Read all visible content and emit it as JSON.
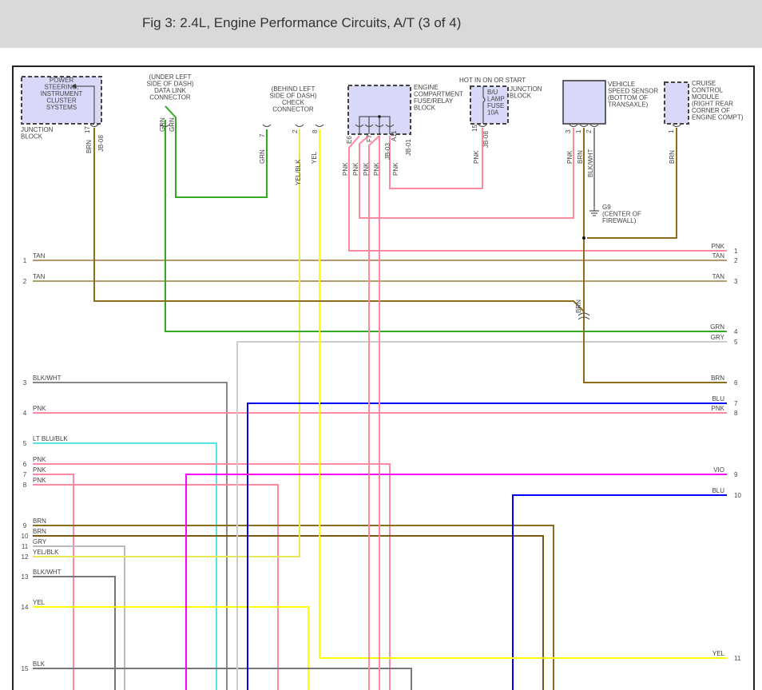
{
  "header": {
    "title": "Fig 3: 2.4L, Engine Performance Circuits, A/T (3 of 4)"
  },
  "components": {
    "power_steering": [
      "POWER",
      "STEERING,",
      "INSTRUMENT",
      "CLUSTER",
      "SYSTEMS"
    ],
    "junction_block_left": [
      "JUNCTION",
      "BLOCK"
    ],
    "data_link": [
      "(UNDER LEFT",
      "SIDE OF DASH)",
      "DATA LINK",
      "CONNECTOR"
    ],
    "check_connector": [
      "(BEHIND LEFT",
      "SIDE OF DASH)",
      "CHECK",
      "CONNECTOR"
    ],
    "fuse_relay": [
      "ENGINE",
      "COMPARTMENT",
      "FUSE/RELAY",
      "BLOCK"
    ],
    "hot_in": "HOT IN ON OR START",
    "bu_fuse": [
      "B/U",
      "LAMP",
      "FUSE",
      "10A"
    ],
    "junction_block_right": [
      "JUNCTION",
      "BLOCK"
    ],
    "vss": [
      "VEHICLE",
      "SPEED SENSOR",
      "(BOTTOM OF",
      "TRANSAXLE)"
    ],
    "cruise": [
      "CRUISE",
      "CONTROL",
      "MODULE",
      "(RIGHT REAR",
      "CORNER OF",
      "ENGINE COMPT)"
    ],
    "ground": [
      "G9",
      "(CENTER OF",
      "FIREWALL)"
    ]
  },
  "top_pins": {
    "jb17": "17",
    "jb08a": "JB-08",
    "brn1": "BRN",
    "dl7": "7",
    "grn1": "GRN",
    "grn2": "GRN",
    "cc7": "7",
    "cc2": "2",
    "cc8": "8",
    "grn3": "GRN",
    "yelblk": "YEL/BLK",
    "yel": "YEL",
    "e6": "E6",
    "f7": "F7",
    "a11": "A11",
    "jb03": "JB-03",
    "jb01": "JB-01",
    "pnk1": "PNK",
    "pnk2": "PNK",
    "pnk3": "PNK",
    "pnk4": "PNK",
    "pnk5": "PNK",
    "f15": "15",
    "jb08b": "JB-08",
    "pnk6": "PNK",
    "v3": "3",
    "v1": "1",
    "v2": "2",
    "pnk7": "PNK",
    "brn2": "BRN",
    "blkwht": "BLK/WHT",
    "c1": "1",
    "brn3": "BRN",
    "brn4": "BRN"
  },
  "left_wires": [
    {
      "num": "1",
      "label": "TAN",
      "color": "#b59b6f"
    },
    {
      "num": "2",
      "label": "TAN",
      "color": "#b59b6f"
    },
    {
      "num": "3",
      "label": "BLK/WHT",
      "color": "#888888"
    },
    {
      "num": "4",
      "label": "PNK",
      "color": "#ff8aa0"
    },
    {
      "num": "5",
      "label": "LT BLU/BLK",
      "color": "#55e5e5"
    },
    {
      "num": "6",
      "label": "PNK",
      "color": "#ff8aa0"
    },
    {
      "num": "7",
      "label": "PNK",
      "color": "#ff8aa0"
    },
    {
      "num": "8",
      "label": "PNK",
      "color": "#ff8aa0"
    },
    {
      "num": "9",
      "label": "BRN",
      "color": "#8b6d1c"
    },
    {
      "num": "10",
      "label": "BRN",
      "color": "#7a5a10"
    },
    {
      "num": "11",
      "label": "GRY",
      "color": "#bbbbbb"
    },
    {
      "num": "12",
      "label": "YEL/BLK",
      "color": "#e8e850"
    },
    {
      "num": "13",
      "label": "BLK/WHT",
      "color": "#777777"
    },
    {
      "num": "14",
      "label": "YEL",
      "color": "#ffff00"
    },
    {
      "num": "15",
      "label": "BLK",
      "color": "#777777"
    }
  ],
  "right_wires": [
    {
      "num": "1",
      "label": "PNK",
      "color": "#ff8aa0"
    },
    {
      "num": "2",
      "label": "TAN",
      "color": "#b59b6f"
    },
    {
      "num": "3",
      "label": "TAN",
      "color": "#b59b6f"
    },
    {
      "num": "4",
      "label": "GRN",
      "color": "#33aa22"
    },
    {
      "num": "5",
      "label": "GRY",
      "color": "#cccccc"
    },
    {
      "num": "6",
      "label": "BRN",
      "color": "#8b6d1c"
    },
    {
      "num": "7",
      "label": "BLU",
      "color": "#0000ff"
    },
    {
      "num": "8",
      "label": "PNK",
      "color": "#ff8aa0"
    },
    {
      "num": "9",
      "label": "VIO",
      "color": "#ff00ff"
    },
    {
      "num": "10",
      "label": "BLU",
      "color": "#0000ff"
    },
    {
      "num": "11",
      "label": "YEL",
      "color": "#ffff00"
    }
  ],
  "splice_label": "BRN"
}
